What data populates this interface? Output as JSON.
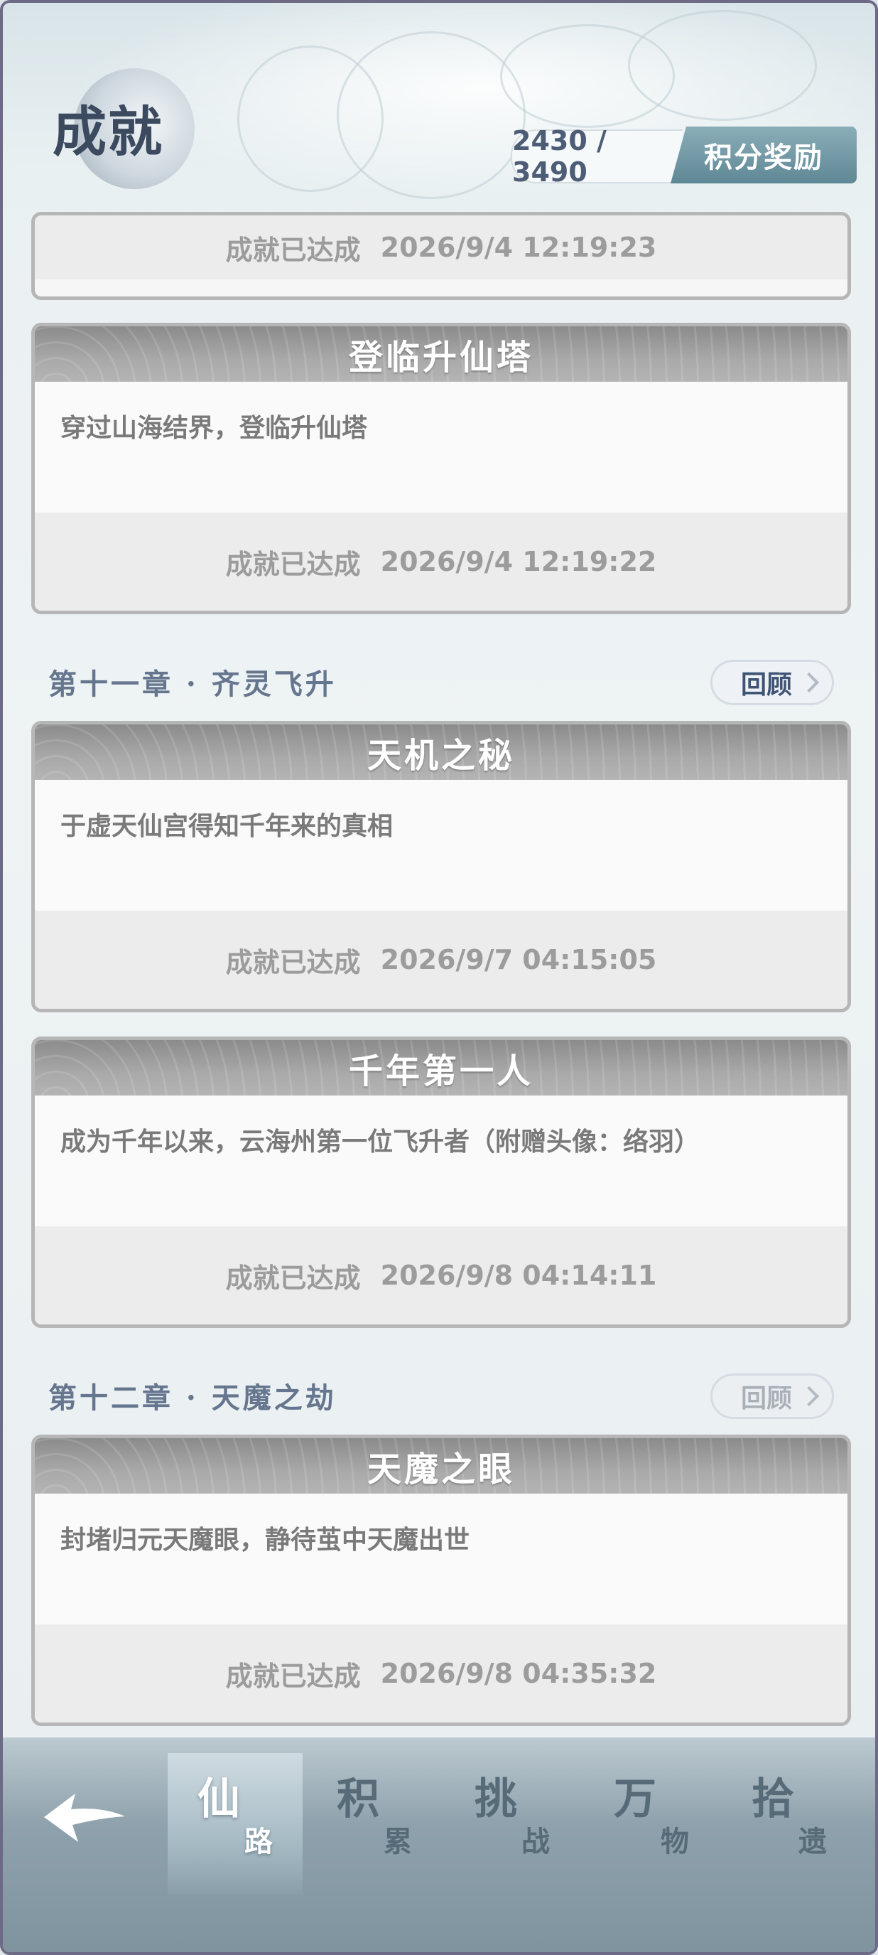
{
  "header": {
    "title": "成就",
    "score": "2430 / 3490",
    "reward_button": "积分奖励"
  },
  "cards": [
    {
      "name": "",
      "description": "",
      "status": "成就已达成",
      "time": "2026/9/4 12:19:23"
    },
    {
      "name": "登临升仙塔",
      "description": "穿过山海结界，登临升仙塔",
      "status": "成就已达成",
      "time": "2026/9/4 12:19:22"
    },
    {
      "name": "天机之秘",
      "description": "于虚天仙宫得知千年来的真相",
      "status": "成就已达成",
      "time": "2026/9/7 04:15:05"
    },
    {
      "name": "千年第一人",
      "description": "成为千年以来，云海州第一位飞升者（附赠头像：络羽）",
      "status": "成就已达成",
      "time": "2026/9/8 04:14:11"
    },
    {
      "name": "天魔之眼",
      "description": "封堵归元天魔眼，静待茧中天魔出世",
      "status": "成就已达成",
      "time": "2026/9/8 04:35:32"
    }
  ],
  "chapters": [
    {
      "title": "第十一章 · 齐灵飞升",
      "review": "回顾"
    },
    {
      "title": "第十二章 · 天魔之劫",
      "review": "回顾"
    }
  ],
  "nav": {
    "tabs": [
      {
        "big": "仙",
        "small": "路"
      },
      {
        "big": "积",
        "small": "累"
      },
      {
        "big": "挑",
        "small": "战"
      },
      {
        "big": "万",
        "small": "物"
      },
      {
        "big": "拾",
        "small": "遗"
      }
    ]
  }
}
